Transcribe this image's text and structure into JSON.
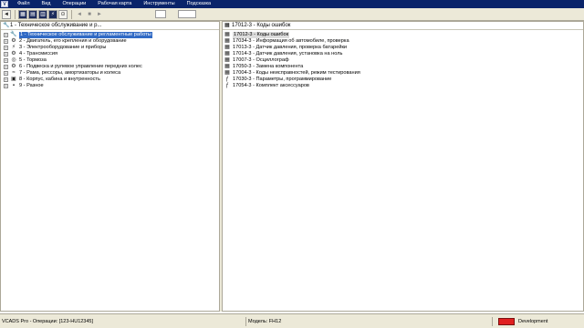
{
  "app": {
    "icon_label": "V"
  },
  "menu": [
    "Файл",
    "Вид",
    "Операции",
    "Рабочая карта",
    "Инструменты",
    "Подсказка"
  ],
  "toolbar": {
    "buttons": [
      "◄",
      "▦",
      "▤",
      "▥",
      "⚡",
      "⊙",
      "◄",
      "■",
      "►",
      "",
      "",
      "",
      "",
      "",
      "",
      ""
    ]
  },
  "left_panel": {
    "header": "1 - Техническое обслуживание и р...",
    "items": [
      {
        "expander": "+",
        "icon": "🔧",
        "label": "1 - Техническое обслуживание и регламентные работы",
        "selected": true
      },
      {
        "expander": "+",
        "icon": "⚙",
        "label": "2 - Двигатель, его крепления и оборудование",
        "selected": false
      },
      {
        "expander": "+",
        "icon": "⚡",
        "label": "3 - Электрооборудование и приборы",
        "selected": false
      },
      {
        "expander": "+",
        "icon": "⚙",
        "label": "4 - Трансмиссия",
        "selected": false
      },
      {
        "expander": "+",
        "icon": "◎",
        "label": "5 - Тормоза",
        "selected": false
      },
      {
        "expander": "+",
        "icon": "⚙",
        "label": "6 - Подвеска и рулевое управление передних колес",
        "selected": false
      },
      {
        "expander": "+",
        "icon": "≈",
        "label": "7 - Рама, рессоры, амортизаторы и колеса",
        "selected": false
      },
      {
        "expander": "+",
        "icon": "▣",
        "label": "8 - Корпус, кабина и внутренность",
        "selected": false
      },
      {
        "expander": "+",
        "icon": "▪",
        "label": "9 - Разное",
        "selected": false
      }
    ]
  },
  "right_panel": {
    "header": "17012-3 - Коды ошибок",
    "items": [
      {
        "icon": "▦",
        "label": "17012-3 - Коды ошибок",
        "selected": true
      },
      {
        "icon": "▦",
        "label": "17034-3 - Информация об автомобиле, проверка",
        "selected": false
      },
      {
        "icon": "▦",
        "label": "17013-3 - Датчик давления, проверка батарейки",
        "selected": false
      },
      {
        "icon": "▦",
        "label": "17014-3 - Датчик давления, установка на ноль",
        "selected": false
      },
      {
        "icon": "▦",
        "label": "17007-3 - Осциллограф",
        "selected": false
      },
      {
        "icon": "▦",
        "label": "17050-3 - Замена компонента",
        "selected": false
      },
      {
        "icon": "▦",
        "label": "17004-3 - Коды неисправностей, режим тестирования",
        "selected": false
      },
      {
        "icon": "ƒ",
        "label": "17030-3 - Параметры, программирование",
        "selected": false
      },
      {
        "icon": "ƒ",
        "label": "17054-3 - Комплект аксессуаров",
        "selected": false
      }
    ]
  },
  "status": {
    "left": "VCADS Pro - Операции: [123-HU12345]",
    "middle": "Модель: FH12",
    "mode": "Development",
    "mode_color": "#e02020"
  }
}
